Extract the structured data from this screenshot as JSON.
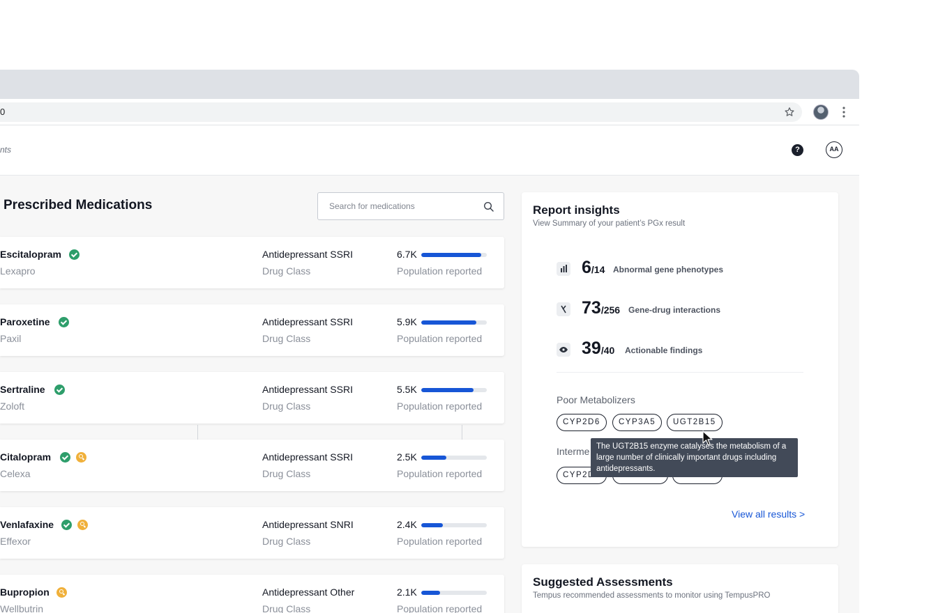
{
  "browser": {
    "url_fragment": "0",
    "star_icon": "star-icon",
    "menu_icon": "kebab-icon"
  },
  "header": {
    "breadcrumb": "nts",
    "help_icon_glyph": "?",
    "avatar_initials": "AA"
  },
  "medications": {
    "title": "Prescribed Medications",
    "search_placeholder": "Search for  medications",
    "accent_color": "#1756d6",
    "items": [
      {
        "name": "Escitalopram",
        "brand": "Lexapro",
        "class": "Antidepressant SSRI",
        "class_label": "Drug Class",
        "population": "6.7K",
        "population_label": "Population reported",
        "fill": 0.91,
        "badges": [
          "ok"
        ]
      },
      {
        "name": "Paroxetine",
        "brand": "Paxil",
        "class": "Antidepressant SSRI",
        "class_label": "Drug Class",
        "population": "5.9K",
        "population_label": "Population reported",
        "fill": 0.84,
        "badges": [
          "ok"
        ]
      },
      {
        "name": "Sertraline",
        "brand": "Zoloft",
        "class": "Antidepressant SSRI",
        "class_label": "Drug Class",
        "population": "5.5K",
        "population_label": "Population reported",
        "fill": 0.8,
        "badges": [
          "ok"
        ]
      },
      {
        "name": "Citalopram",
        "brand": "Celexa",
        "class": "Antidepressant SSRI",
        "class_label": "Drug Class",
        "population": "2.5K",
        "population_label": "Population reported",
        "fill": 0.38,
        "badges": [
          "ok",
          "warn"
        ]
      },
      {
        "name": "Venlafaxine",
        "brand": "Effexor",
        "class": "Antidepressant SNRI",
        "class_label": "Drug Class",
        "population": "2.4K",
        "population_label": "Population reported",
        "fill": 0.33,
        "badges": [
          "ok",
          "warn"
        ]
      },
      {
        "name": "Bupropion",
        "brand": "Wellbutrin",
        "class": "Antidepressant Other",
        "class_label": "Drug Class",
        "population": "2.1K",
        "population_label": "Population reported",
        "fill": 0.29,
        "badges": [
          "warn"
        ]
      }
    ]
  },
  "insights": {
    "title": "Report insights",
    "subtitle": "View Summary of your patient’s PGx result",
    "stats": [
      {
        "value": "6",
        "total": "/14",
        "label": "Abnormal gene phenotypes",
        "icon": "bars-icon"
      },
      {
        "value": "73",
        "total": "/256",
        "label": "Gene-drug interactions",
        "icon": "interaction-icon"
      },
      {
        "value": "39",
        "total": "/40",
        "label": "Actionable findings",
        "icon": "eye-icon"
      }
    ],
    "poor_title": "Poor Metabolizers",
    "poor_genes": [
      "CYP2D6",
      "CYP3A5",
      "UGT2B15"
    ],
    "intermediate_title": "Interme",
    "intermediate_genes": [
      "CYP2D6",
      "CYP2C19",
      "CYP2C9"
    ],
    "view_all": "View all results >",
    "tooltip": "The UGT2B15 enzyme catalyses the metabolism of a large number of clinically important drugs including antidepressants."
  },
  "assessments": {
    "title": "Suggested Assessments",
    "subtitle": "Tempus recommended assessments to monitor using TempusPRO"
  }
}
